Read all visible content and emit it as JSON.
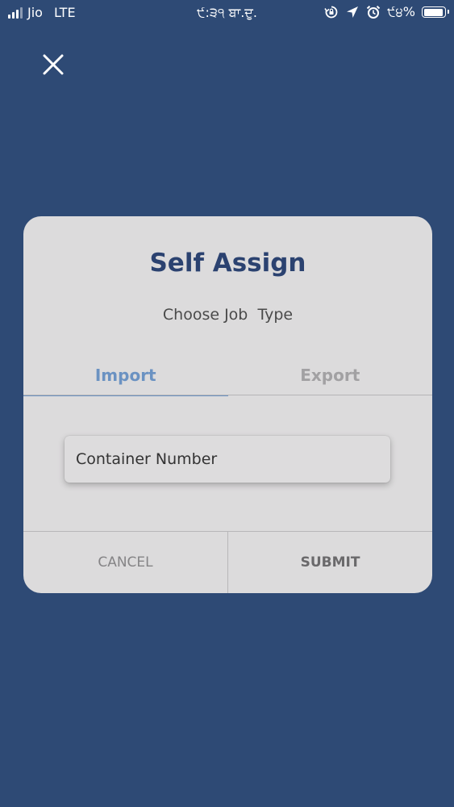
{
  "status_bar": {
    "carrier": "Jio",
    "network": "LTE",
    "time": "੯:੩੧ ਬਾ.ਦੁ.",
    "battery_text": "੯੪%",
    "battery_level": 0.94,
    "icons": [
      "signal-icon",
      "orientation-lock-icon",
      "location-arrow-icon",
      "alarm-icon",
      "battery-icon"
    ]
  },
  "close_icon": "close-icon",
  "dialog": {
    "title": "Self Assign",
    "subtitle": "Choose Job  Type",
    "tabs": [
      {
        "label": "Import",
        "active": true
      },
      {
        "label": "Export",
        "active": false
      }
    ],
    "input": {
      "placeholder": "Container Number",
      "value": ""
    },
    "buttons": {
      "cancel": "CANCEL",
      "submit": "SUBMIT"
    }
  },
  "colors": {
    "background": "#2e4a75",
    "dialog_bg": "#dcdbdc",
    "title": "#2b4270",
    "active_tab": "#6b92c2",
    "inactive_tab": "#a2a1a3"
  }
}
